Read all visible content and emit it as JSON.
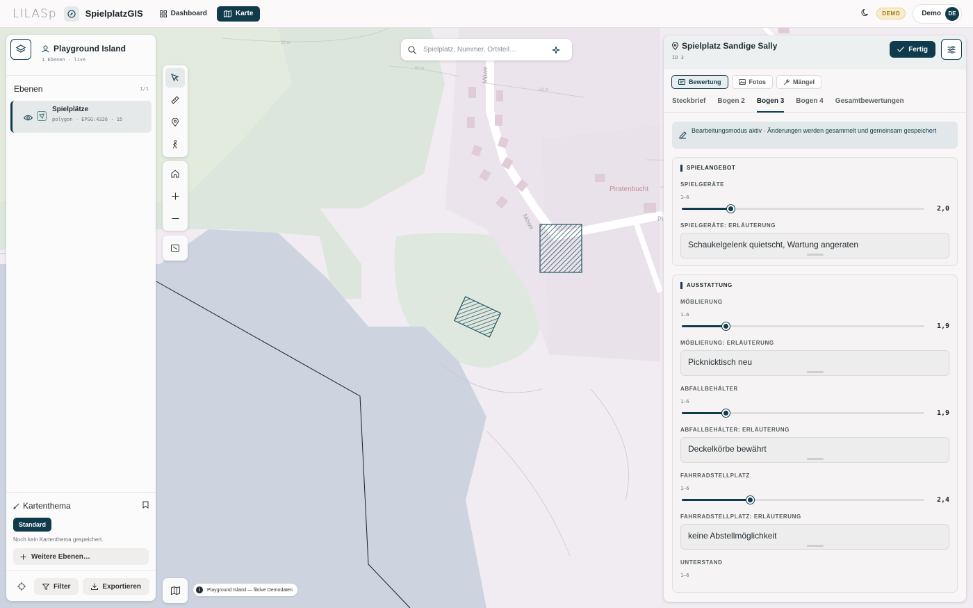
{
  "topbar": {
    "logo": "LILASp",
    "app_title": "SpielplatzGIS",
    "nav": [
      {
        "label": "Dashboard",
        "icon": "grid-icon"
      },
      {
        "label": "Karte",
        "icon": "map-icon",
        "active": true
      }
    ],
    "demo_badge": "DEMO",
    "user_name": "Demo",
    "user_initials": "DE"
  },
  "left_panel": {
    "project_title": "Playground Island",
    "project_sub": "1 Ebenen · live",
    "ebenen_title": "Ebenen",
    "ebenen_count": "1/1",
    "layer": {
      "name": "Spielplätze",
      "meta": "polygon · EPSG:4326 · 15"
    },
    "theme_title": "Kartenthema",
    "theme_button": "Standard",
    "theme_note": "Noch kein Kartenthema gespeichert.",
    "more_layers": "Weitere Ebenen…",
    "filter_label": "Filter",
    "export_label": "Exportieren"
  },
  "search": {
    "placeholder": "Spielplatz, Nummer, Ortsteil…"
  },
  "map": {
    "attribution": "Playground Island — fiktive Demodaten",
    "labels": {
      "street1": "Möwe",
      "place": "Piratenbucht",
      "street2": "Pi",
      "contour1": "50 m",
      "contour2": "50 m",
      "contour3": "50 m",
      "piratenbucht2": "Piratenbucht"
    }
  },
  "right_panel": {
    "title": "Spielplatz Sandige Sally",
    "id_label": "ID 3",
    "done_label": "Fertig",
    "chips": [
      {
        "label": "Bewertung",
        "icon": "rating-icon",
        "active": true
      },
      {
        "label": "Fotos",
        "icon": "photo-icon"
      },
      {
        "label": "Mängel",
        "icon": "wrench-icon"
      }
    ],
    "tabs": [
      {
        "label": "Steckbrief"
      },
      {
        "label": "Bogen 2"
      },
      {
        "label": "Bogen 3",
        "active": true
      },
      {
        "label": "Bogen 4"
      },
      {
        "label": "Gesamtbewertungen"
      }
    ],
    "notice": "Bearbeitungsmodus aktiv · Änderungen werden gesammelt und gemeinsam gespeichert",
    "sections": [
      {
        "title": "SPIELANGEBOT",
        "fields": [
          {
            "label": "SPIELGERÄTE",
            "range": "1–6",
            "value": 2.0,
            "value_text": "2,0",
            "note_label": "SPIELGERÄTE: ERLÄUTERUNG",
            "note": "Schaukelgelenk quietscht, Wartung angeraten"
          }
        ]
      },
      {
        "title": "AUSSTATTUNG",
        "fields": [
          {
            "label": "MÖBLIERUNG",
            "range": "1–6",
            "value": 1.9,
            "value_text": "1,9",
            "note_label": "MÖBLIERUNG: ERLÄUTERUNG",
            "note": "Picknicktisch neu"
          },
          {
            "label": "ABFALLBEHÄLTER",
            "range": "1–6",
            "value": 1.9,
            "value_text": "1,9",
            "note_label": "ABFALLBEHÄLTER: ERLÄUTERUNG",
            "note": "Deckelkörbe bewährt"
          },
          {
            "label": "FAHRRADSTELLPLATZ",
            "range": "1–6",
            "value": 2.4,
            "value_text": "2,4",
            "note_label": "FAHRRADSTELLPLATZ: ERLÄUTERUNG",
            "note": "keine Abstellmöglichkeit"
          },
          {
            "label": "UNTERSTAND",
            "range": "1–6"
          }
        ]
      }
    ]
  },
  "colors": {
    "primary": "#0f3b4c",
    "water": "#cdd4e0",
    "land": "#f1ecf1",
    "forest": "#dde6dd"
  }
}
